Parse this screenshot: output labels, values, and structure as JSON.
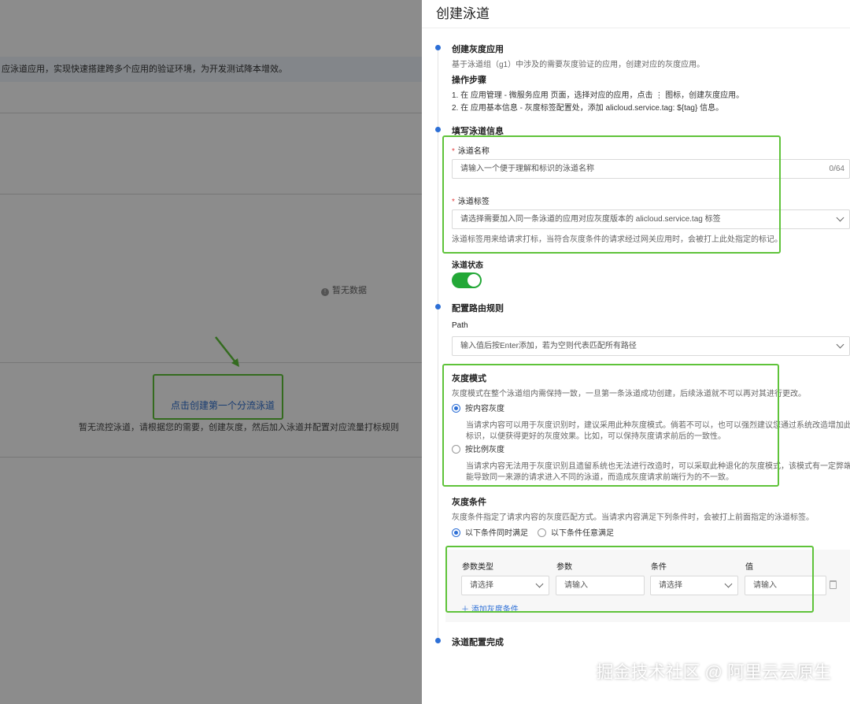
{
  "background": {
    "banner_text": "应泳道应用，实现快速搭建跨多个应用的验证环境，为开发测试降本增效。",
    "no_data": "暂无数据",
    "create_first_link": "点击创建第一个分流泳道",
    "hint_text": "暂无流控泳道，请根据您的需要，创建灰度，然后加入泳道并配置对应流量打标规则"
  },
  "drawer": {
    "title": "创建泳道",
    "step1": {
      "title": "创建灰度应用",
      "desc": "基于泳道组（g1）中涉及的需要灰度验证的应用，创建对应的灰度应用。",
      "ops_title": "操作步骤",
      "op1": "1. 在 应用管理 - 微服务应用 页面，选择对应的应用，点击 ⋮ 图标，创建灰度应用。",
      "op2": "2. 在 应用基本信息 - 灰度标签配置处，添加 alicloud.service.tag: ${tag} 信息。"
    },
    "step2": {
      "title": "填写泳道信息",
      "name_label": "泳道名称",
      "name_placeholder": "请输入一个便于理解和标识的泳道名称",
      "name_count": "0/64",
      "tag_label": "泳道标签",
      "tag_placeholder": "请选择需要加入同一条泳道的应用对应灰度版本的 alicloud.service.tag 标签",
      "tag_hint": "泳道标签用来给请求打标，当符合灰度条件的请求经过网关应用时，会被打上此处指定的标记。",
      "status_label": "泳道状态",
      "status_on": true
    },
    "step3": {
      "title": "配置路由规则",
      "path_label": "Path",
      "path_placeholder": "输入值后按Enter添加，若为空则代表匹配所有路径",
      "mode_title": "灰度模式",
      "mode_desc": "灰度模式在整个泳道组内需保持一致，一旦第一条泳道成功创建，后续泳道就不可以再对其进行更改。",
      "mode_content_label": "按内容灰度",
      "mode_content_desc1": "当请求内容可以用于灰度识别时，建议采用此种灰度模式。倘若不可以，也可以强烈建议您通过系统改造增加此类灰度",
      "mode_content_desc2": "标识，以便获得更好的灰度效果。比如，可以保持灰度请求前后的一致性。",
      "mode_ratio_label": "按比例灰度",
      "mode_ratio_desc1": "当请求内容无法用于灰度识别且遗留系统也无法进行改造时，可以采取此种退化的灰度模式，该模式有一定弊端，可",
      "mode_ratio_desc2": "能导致同一来源的请求进入不同的泳道，而造成灰度请求前端行为的不一致。",
      "cond_title": "灰度条件",
      "cond_desc": "灰度条件指定了请求内容的灰度匹配方式。当请求内容满足下列条件时，会被打上前面指定的泳道标签。",
      "cond_all": "以下条件同时满足",
      "cond_any": "以下条件任意满足",
      "columns": [
        "参数类型",
        "参数",
        "条件",
        "值"
      ],
      "row": {
        "param_type": "请选择",
        "param": "请输入",
        "condition": "请选择",
        "value": "请输入"
      },
      "add_condition": "＋ 添加灰度条件"
    },
    "step4": {
      "title": "泳道配置完成"
    }
  },
  "watermark": "掘金技术社区 @ 阿里云云原生",
  "colors": {
    "accent": "#2d6fd6",
    "toggle_on": "#23a837",
    "highlight_box": "#5fc33a",
    "required": "#e54545"
  }
}
